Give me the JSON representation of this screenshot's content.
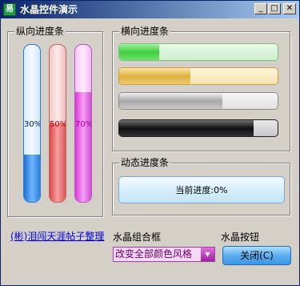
{
  "window": {
    "title": "水晶控件演示",
    "app_icon": "crystal-app-icon",
    "minimize_glyph": "_",
    "maximize_glyph": "□",
    "close_glyph": "✕"
  },
  "vertical_group": {
    "title": "纵向进度条",
    "bars": [
      {
        "label": "30%",
        "value": 30,
        "color": "#2b7fe0"
      },
      {
        "label": "50%",
        "value": 50,
        "color": "#d85858"
      },
      {
        "label": "70%",
        "value": 70,
        "color": "#d050d0"
      }
    ]
  },
  "horizontal_group": {
    "title": "横向进度条",
    "bars": [
      {
        "value": 25,
        "color": "#3fcf3f"
      },
      {
        "value": 45,
        "color": "#e0b040"
      },
      {
        "value": 65,
        "color": "#a8a8a8"
      },
      {
        "value": 85,
        "color": "#101010"
      }
    ]
  },
  "dynamic_group": {
    "title": "动态进度条",
    "label": "当前进度:0%",
    "value": 0
  },
  "credit_link": "(彬)泪闯天涯帖子整理",
  "combo": {
    "heading": "水晶组合框",
    "value": "改变全部颜色风格",
    "arrow_icon": "dropdown-arrow-icon"
  },
  "button_section": {
    "heading": "水晶按钮",
    "close_label": "关闭(C)"
  }
}
